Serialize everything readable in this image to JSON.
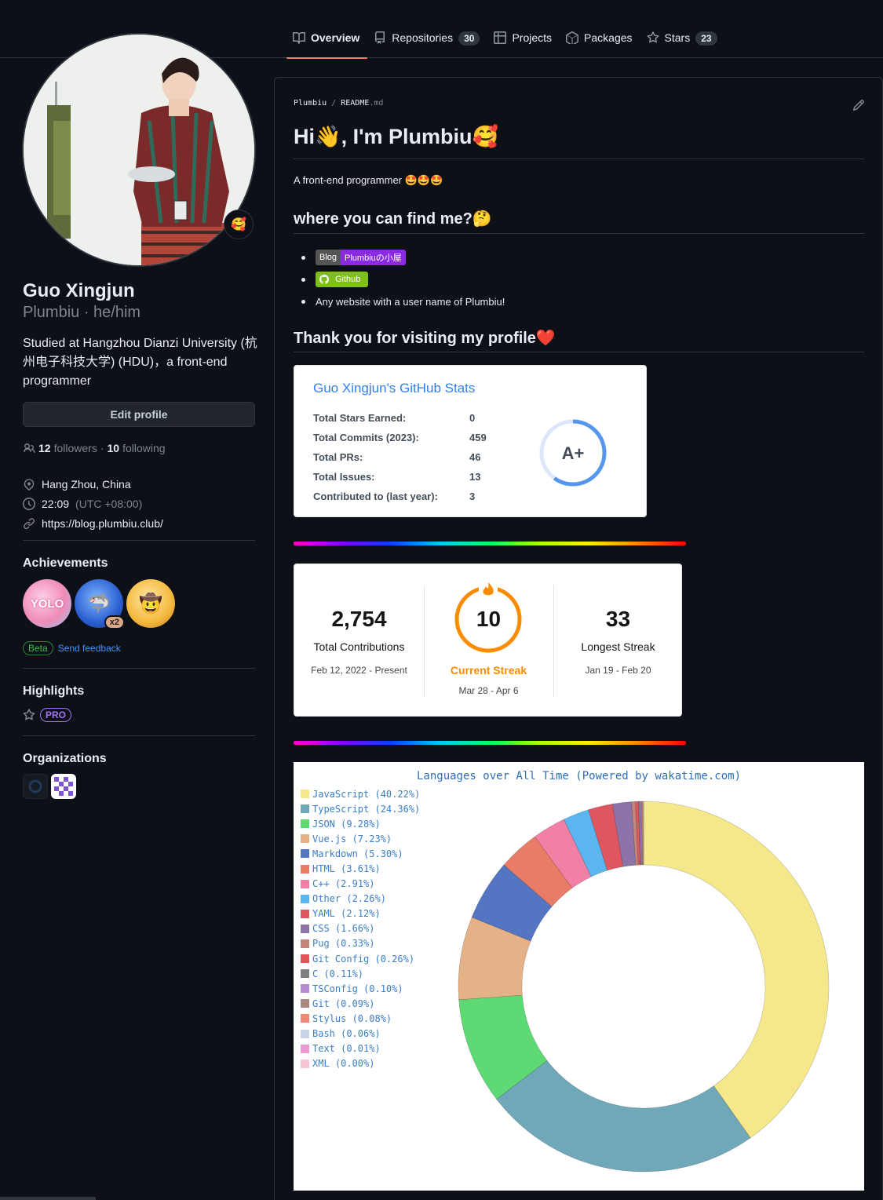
{
  "nav": {
    "tabs": [
      {
        "label": "Overview",
        "count": null
      },
      {
        "label": "Repositories",
        "count": "30"
      },
      {
        "label": "Projects",
        "count": null
      },
      {
        "label": "Packages",
        "count": null
      },
      {
        "label": "Stars",
        "count": "23"
      }
    ]
  },
  "profile": {
    "status_emoji": "🥰",
    "name": "Guo Xingjun",
    "login": "Plumbiu · he/him",
    "bio": "Studied at Hangzhou Dianzi University (杭州电子科技大学) (HDU)，a front-end programmer",
    "edit_label": "Edit profile",
    "followers_count": "12",
    "followers_label": "followers",
    "following_count": "10",
    "following_label": "following",
    "location": "Hang Zhou, China",
    "time": "22:09",
    "timezone": "(UTC +08:00)",
    "website": "https://blog.plumbiu.club/"
  },
  "achievements": {
    "title": "Achievements",
    "badges": [
      {
        "name": "YOLO"
      },
      {
        "name": "Pull Shark",
        "multiplier": "x2"
      },
      {
        "name": "Quickdraw"
      }
    ],
    "beta_label": "Beta",
    "feedback_label": "Send feedback"
  },
  "highlights": {
    "title": "Highlights",
    "pro_label": "PRO"
  },
  "organizations": {
    "title": "Organizations"
  },
  "readme": {
    "path_owner": "Plumbiu",
    "path_sep": "/",
    "path_file": "README",
    "path_ext": ".md",
    "h1": "Hi👋, I'm Plumbiu🥰",
    "intro": "A front-end programmer 🤩🤩🤩",
    "find_heading": "where you can find me?🤔",
    "blog_shield_left": "Blog",
    "blog_shield_right": "Plumbiuの小屋",
    "github_shield": "Github",
    "any_website": "Any website with a user name of Plumbiu!",
    "thanks_heading": "Thank you for visiting my profile❤️"
  },
  "stats": {
    "title": "Guo Xingjun's GitHub Stats",
    "rows": [
      {
        "label": "Total Stars Earned:",
        "value": "0"
      },
      {
        "label": "Total Commits (2023):",
        "value": "459"
      },
      {
        "label": "Total PRs:",
        "value": "46"
      },
      {
        "label": "Total Issues:",
        "value": "13"
      },
      {
        "label": "Contributed to (last year):",
        "value": "3"
      }
    ],
    "rank": "A+",
    "rank_progress": 0.6
  },
  "streak": {
    "total": "2,754",
    "total_label": "Total Contributions",
    "total_range": "Feb 12, 2022 - Present",
    "current": "10",
    "current_label": "Current Streak",
    "current_range": "Mar 28 - Apr 6",
    "longest": "33",
    "longest_label": "Longest Streak",
    "longest_range": "Jan 19 - Feb 20"
  },
  "chart_data": {
    "type": "pie",
    "title": "Languages over All Time (Powered by wakatime.com)",
    "legend": "top-left",
    "donut": true,
    "slices": [
      {
        "label": "JavaScript (40.22%)",
        "name": "JavaScript",
        "value": 40.22,
        "color": "#f5e88a"
      },
      {
        "label": "TypeScript (24.36%)",
        "name": "TypeScript",
        "value": 24.36,
        "color": "#6fa8b9"
      },
      {
        "label": "JSON (9.28%)",
        "name": "JSON",
        "value": 9.28,
        "color": "#5fd974"
      },
      {
        "label": "Vue.js (7.23%)",
        "name": "Vue.js",
        "value": 7.23,
        "color": "#e5b288"
      },
      {
        "label": "Markdown (5.30%)",
        "name": "Markdown",
        "value": 5.3,
        "color": "#5475c2"
      },
      {
        "label": "HTML (3.61%)",
        "name": "HTML",
        "value": 3.61,
        "color": "#e97c66"
      },
      {
        "label": "C++ (2.91%)",
        "name": "C++",
        "value": 2.91,
        "color": "#f27fa4"
      },
      {
        "label": "Other (2.26%)",
        "name": "Other",
        "value": 2.26,
        "color": "#5bb6f0"
      },
      {
        "label": "YAML (2.12%)",
        "name": "YAML",
        "value": 2.12,
        "color": "#e05660"
      },
      {
        "label": "CSS (1.66%)",
        "name": "CSS",
        "value": 1.66,
        "color": "#8c74a8"
      },
      {
        "label": "Pug (0.33%)",
        "name": "Pug",
        "value": 0.33,
        "color": "#c4867a"
      },
      {
        "label": "Git Config (0.26%)",
        "name": "Git Config",
        "value": 0.26,
        "color": "#e0565c"
      },
      {
        "label": "C (0.11%)",
        "name": "C",
        "value": 0.11,
        "color": "#808080"
      },
      {
        "label": "TSConfig (0.10%)",
        "name": "TSConfig",
        "value": 0.1,
        "color": "#b58ad0"
      },
      {
        "label": "Git (0.09%)",
        "name": "Git",
        "value": 0.09,
        "color": "#a98a82"
      },
      {
        "label": "Stylus (0.08%)",
        "name": "Stylus",
        "value": 0.08,
        "color": "#f0897a"
      },
      {
        "label": "Bash (0.06%)",
        "name": "Bash",
        "value": 0.06,
        "color": "#c7d4e6"
      },
      {
        "label": "Text (0.01%)",
        "name": "Text",
        "value": 0.01,
        "color": "#ec9ad2"
      },
      {
        "label": "XML (0.00%)",
        "name": "XML",
        "value": 0.0,
        "color": "#f7c6d6"
      }
    ]
  }
}
